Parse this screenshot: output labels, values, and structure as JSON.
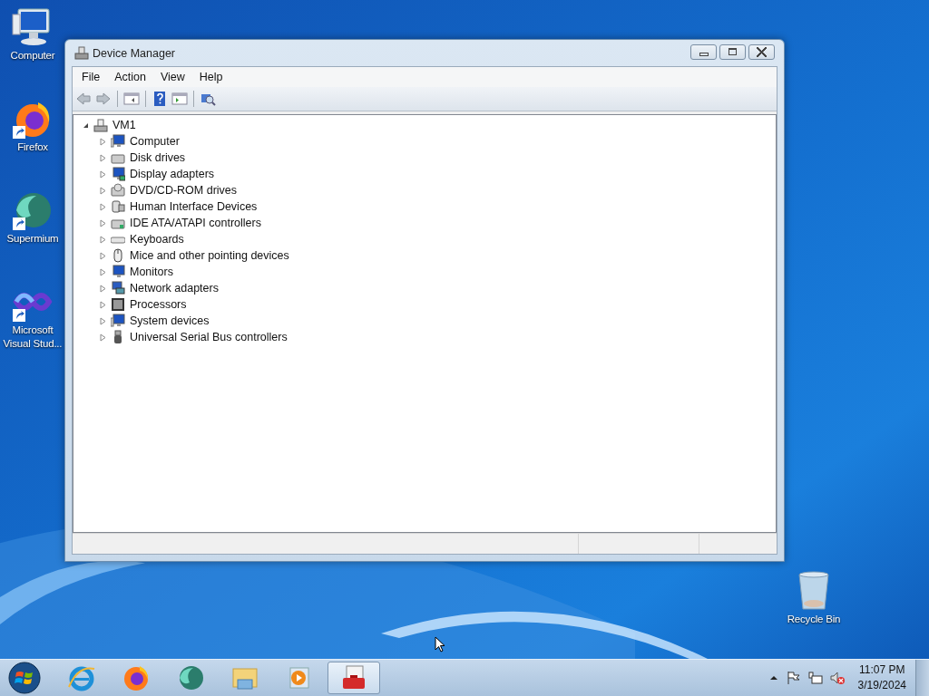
{
  "desktop_icons": [
    {
      "label": "Computer",
      "kind": "computer",
      "shortcut": false
    },
    {
      "label": "Firefox",
      "kind": "firefox",
      "shortcut": true
    },
    {
      "label": "Supermium",
      "kind": "supermium",
      "shortcut": true
    },
    {
      "label": "Microsoft Visual Stud...",
      "kind": "vs",
      "shortcut": true
    }
  ],
  "recycle_bin": {
    "label": "Recycle Bin"
  },
  "window": {
    "title": "Device Manager",
    "menu": [
      "File",
      "Action",
      "View",
      "Help"
    ],
    "tree": {
      "label": "VM1",
      "expanded": true,
      "children": [
        {
          "label": "Computer",
          "kind": "computer",
          "expanded": false
        },
        {
          "label": "Disk drives",
          "kind": "disk",
          "expanded": false
        },
        {
          "label": "Display adapters",
          "kind": "display",
          "expanded": false
        },
        {
          "label": "DVD/CD-ROM drives",
          "kind": "optical",
          "expanded": false
        },
        {
          "label": "Human Interface Devices",
          "kind": "hid",
          "expanded": false
        },
        {
          "label": "IDE ATA/ATAPI controllers",
          "kind": "ide",
          "expanded": false
        },
        {
          "label": "Keyboards",
          "kind": "keyboard",
          "expanded": false
        },
        {
          "label": "Mice and other pointing devices",
          "kind": "mouse",
          "expanded": false
        },
        {
          "label": "Monitors",
          "kind": "monitor",
          "expanded": false
        },
        {
          "label": "Network adapters",
          "kind": "network",
          "expanded": false
        },
        {
          "label": "Processors",
          "kind": "processor",
          "expanded": false
        },
        {
          "label": "System devices",
          "kind": "system",
          "expanded": false
        },
        {
          "label": "Universal Serial Bus controllers",
          "kind": "usb",
          "expanded": false
        }
      ]
    }
  },
  "taskbar": {
    "apps": [
      {
        "kind": "ie",
        "selected": false
      },
      {
        "kind": "firefox",
        "selected": false
      },
      {
        "kind": "supermium",
        "selected": false
      },
      {
        "kind": "explorer",
        "selected": false
      },
      {
        "kind": "media",
        "selected": false
      },
      {
        "kind": "devmgr",
        "selected": true
      }
    ],
    "time": "11:07 PM",
    "date": "3/19/2024"
  }
}
